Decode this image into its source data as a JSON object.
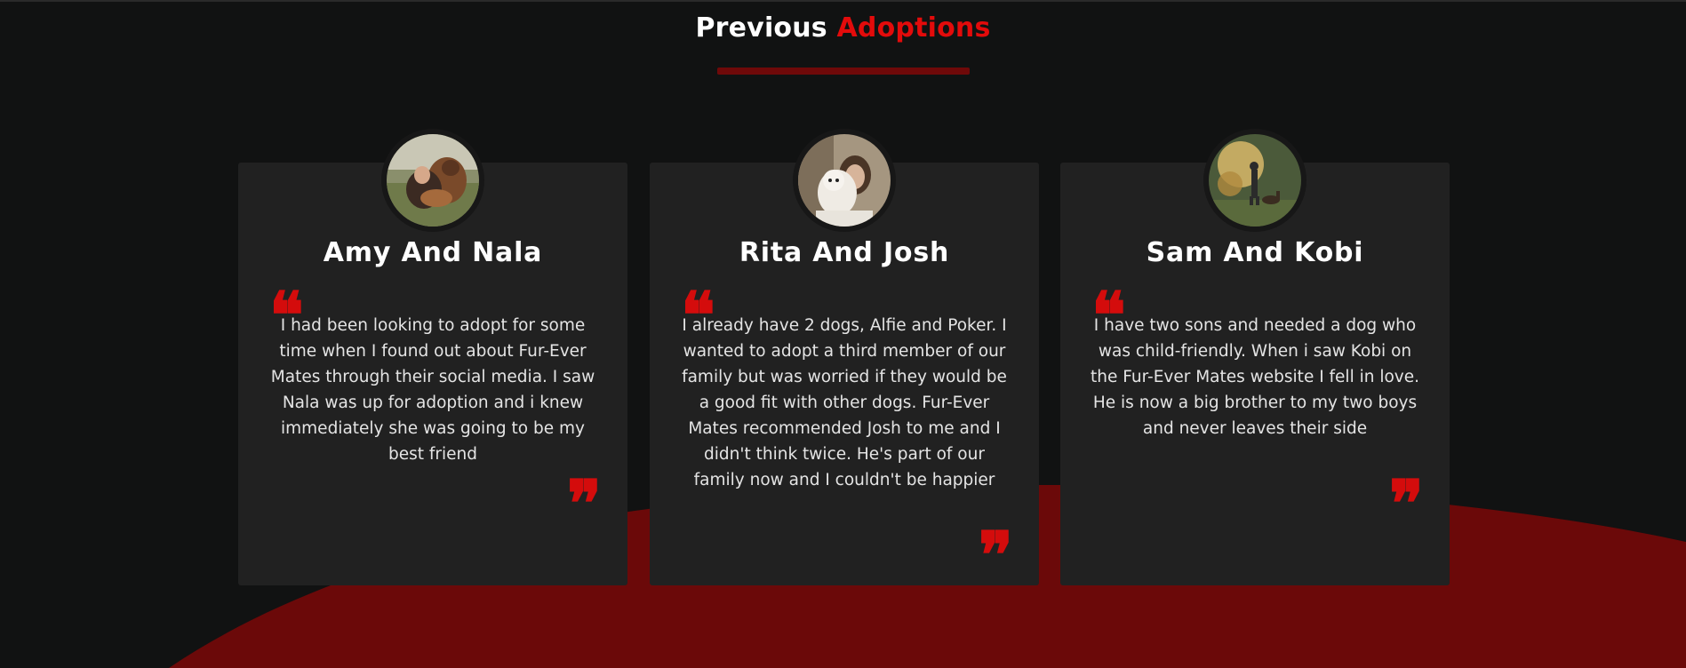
{
  "section": {
    "title_prefix": "Previous",
    "title_accent": "Adoptions"
  },
  "colors": {
    "background": "#111212",
    "card": "#212121",
    "accent_red": "#e30b0b",
    "swoosh_red": "#6b0909",
    "text": "#ffffff"
  },
  "testimonials": [
    {
      "name": "Amy And Nala",
      "text": "I had been looking to adopt for some time when I found out about Fur-Ever Mates through their social media. I saw Nala was up for adoption and i knew immediately she was going to be my best friend",
      "photo": "woman-hugging-dog-photo"
    },
    {
      "name": "Rita And Josh",
      "text": "I already have 2 dogs, Alfie and Poker. I wanted to adopt a third member of our family but was worried if they would be a good fit with other dogs. Fur-Ever Mates recommended Josh to me and I didn't think twice. He's part of our family now and I couldn't be happier",
      "photo": "woman-with-white-dog-photo"
    },
    {
      "name": "Sam And Kobi",
      "text": "I have two sons and needed a dog who was child-friendly. When i saw Kobi on the Fur-Ever Mates website I fell in love. He is now a big brother to my two boys and never leaves their side",
      "photo": "man-walking-dog-photo"
    }
  ],
  "icons": {
    "quote_open": "❝",
    "quote_close": "❞"
  }
}
